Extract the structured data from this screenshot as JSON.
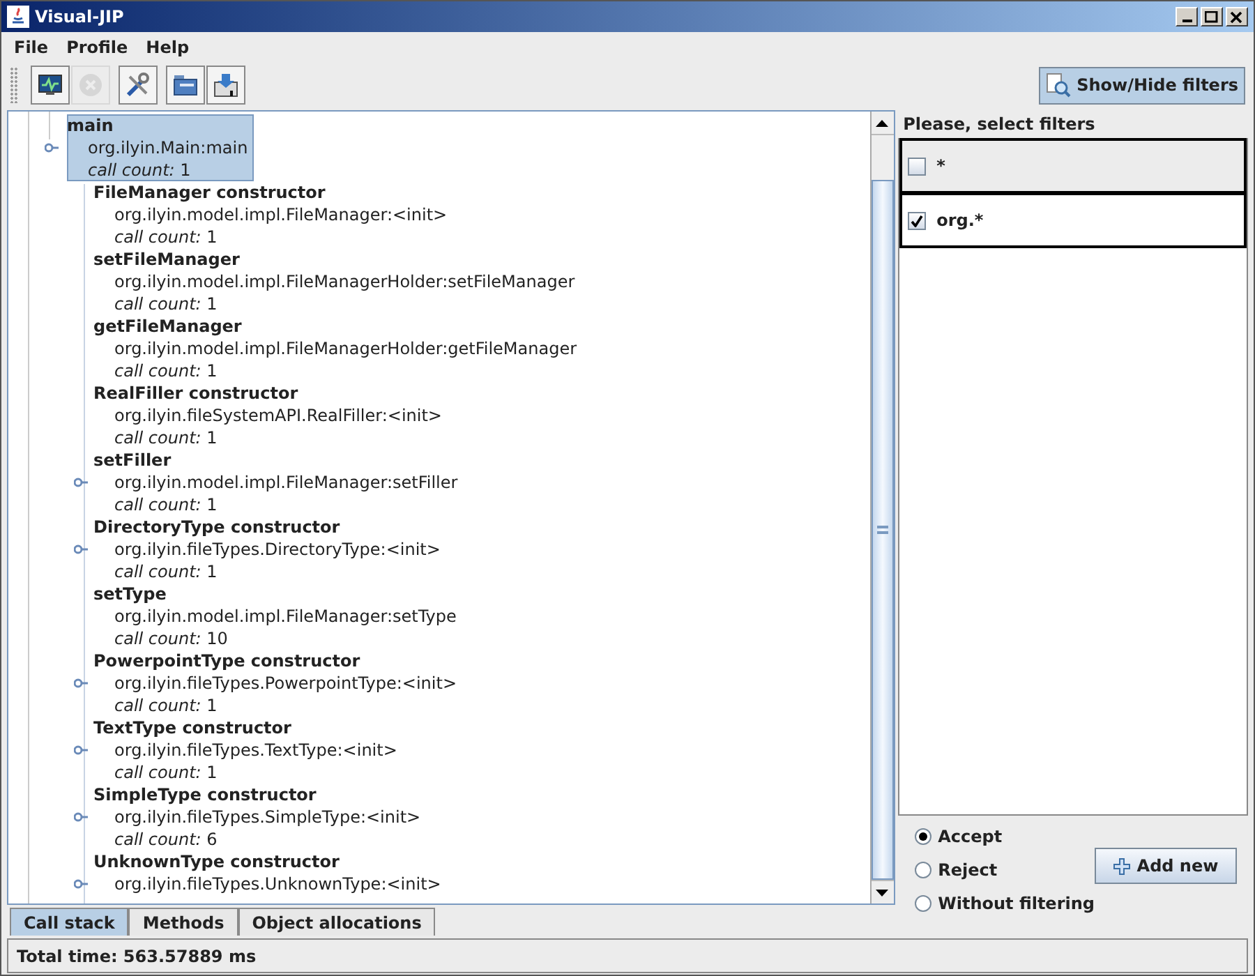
{
  "window": {
    "title": "Visual-JIP"
  },
  "menu": [
    "File",
    "Profile",
    "Help"
  ],
  "toolbar": [
    {
      "kind": "monitor",
      "disabled": false
    },
    {
      "kind": "stop",
      "disabled": true
    },
    {
      "kind": "tools",
      "disabled": false
    },
    {
      "kind": "open",
      "disabled": false
    },
    {
      "kind": "save",
      "disabled": false
    }
  ],
  "filters_toggle": {
    "label": "Show/Hide filters",
    "selected": true
  },
  "tree": {
    "root": {
      "title": "main",
      "method": "org.ilyin.Main:main",
      "count_label": "call count:",
      "count": "1",
      "selected": true,
      "expandable": true,
      "children": [
        {
          "title": "FileManager constructor",
          "method": "org.ilyin.model.impl.FileManager:<init>",
          "count_label": "call count:",
          "count": "1",
          "selected": false,
          "expandable": false
        },
        {
          "title": "setFileManager",
          "method": "org.ilyin.model.impl.FileManagerHolder:setFileManager",
          "count_label": "call count:",
          "count": "1",
          "selected": false,
          "expandable": false
        },
        {
          "title": "getFileManager",
          "method": "org.ilyin.model.impl.FileManagerHolder:getFileManager",
          "count_label": "call count:",
          "count": "1",
          "selected": false,
          "expandable": false
        },
        {
          "title": "RealFiller constructor",
          "method": "org.ilyin.fileSystemAPI.RealFiller:<init>",
          "count_label": "call count:",
          "count": "1",
          "selected": false,
          "expandable": false
        },
        {
          "title": "setFiller",
          "method": "org.ilyin.model.impl.FileManager:setFiller",
          "count_label": "call count:",
          "count": "1",
          "selected": false,
          "expandable": true
        },
        {
          "title": "DirectoryType constructor",
          "method": "org.ilyin.fileTypes.DirectoryType:<init>",
          "count_label": "call count:",
          "count": "1",
          "selected": false,
          "expandable": true
        },
        {
          "title": "setType",
          "method": "org.ilyin.model.impl.FileManager:setType",
          "count_label": "call count:",
          "count": "10",
          "selected": false,
          "expandable": false
        },
        {
          "title": "PowerpointType constructor",
          "method": "org.ilyin.fileTypes.PowerpointType:<init>",
          "count_label": "call count:",
          "count": "1",
          "selected": false,
          "expandable": true
        },
        {
          "title": "TextType constructor",
          "method": "org.ilyin.fileTypes.TextType:<init>",
          "count_label": "call count:",
          "count": "1",
          "selected": false,
          "expandable": true
        },
        {
          "title": "SimpleType constructor",
          "method": "org.ilyin.fileTypes.SimpleType:<init>",
          "count_label": "call count:",
          "count": "6",
          "selected": false,
          "expandable": true
        },
        {
          "title": "UnknownType constructor",
          "method": "org.ilyin.fileTypes.UnknownType:<init>",
          "selected": false,
          "expandable": true
        }
      ]
    }
  },
  "tabs": [
    {
      "label": "Call stack",
      "selected": true
    },
    {
      "label": "Methods",
      "selected": false
    },
    {
      "label": "Object allocations",
      "selected": false
    }
  ],
  "filters": {
    "heading": "Please, select filters",
    "items": [
      {
        "pattern": "*",
        "checked": false,
        "selected": true
      },
      {
        "pattern": "org.*",
        "checked": true,
        "selected": false
      }
    ],
    "modes": [
      {
        "label": "Accept",
        "selected": true
      },
      {
        "label": "Reject",
        "selected": false
      },
      {
        "label": "Without filtering",
        "selected": false
      }
    ],
    "add_button": "Add new"
  },
  "status_bar": "Total time: 563.57889 ms"
}
